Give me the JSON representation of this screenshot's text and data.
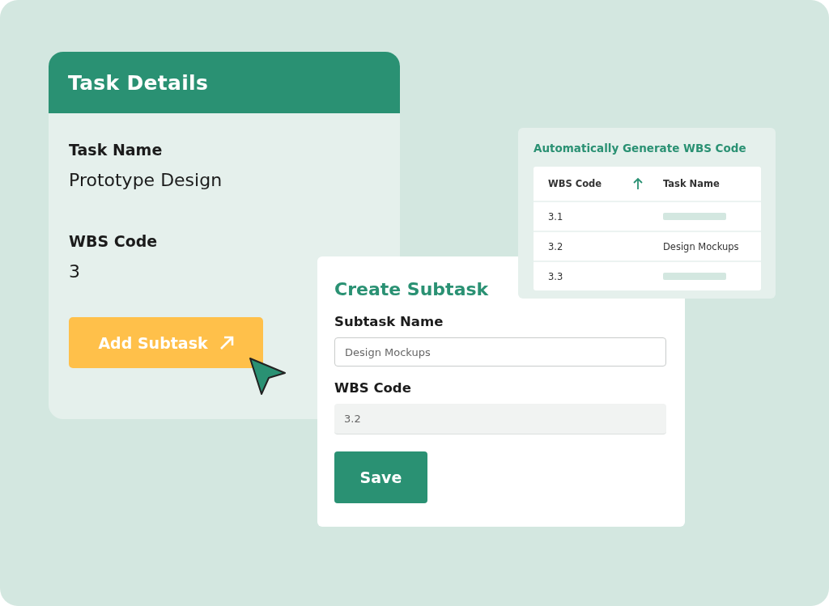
{
  "task_details": {
    "title": "Task Details",
    "fields": [
      {
        "label": "Task Name",
        "value": "Prototype Design"
      },
      {
        "label": "WBS Code",
        "value": "3"
      }
    ],
    "button": "Add Subtask"
  },
  "wbs_panel": {
    "title": "Automatically Generate WBS Code",
    "columns": [
      {
        "label": "WBS Code",
        "sorted_ascending": true
      },
      {
        "label": "Task Name",
        "sorted_ascending": false
      }
    ],
    "rows": [
      {
        "wbs_code": "3.1",
        "task_name": {
          "kind": "skeleton"
        }
      },
      {
        "wbs_code": "3.2",
        "task_name": {
          "kind": "text",
          "text": "Design Mockups"
        }
      },
      {
        "wbs_code": "3.3",
        "task_name": {
          "kind": "skeleton"
        }
      }
    ]
  },
  "create_subtask": {
    "title": "Create Subtask",
    "fields": [
      {
        "label": "Subtask Name",
        "placeholder": "Design Mockups",
        "disabled": false
      },
      {
        "label": "WBS Code",
        "value": "3.2",
        "disabled": true
      }
    ],
    "button": "Save"
  }
}
